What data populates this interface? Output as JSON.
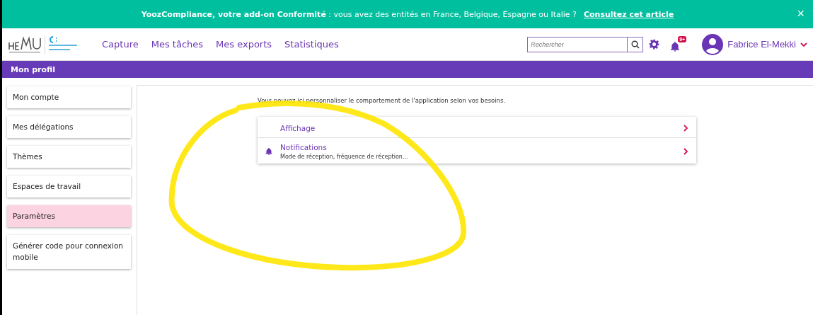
{
  "banner": {
    "text": "**YoozCompliance, votre add-on Conformité** : vous avez des entités en France, Belgique, Espagne ou Italie ?",
    "link": "Consultez cet article",
    "close": "×"
  },
  "header": {
    "nav": [
      {
        "label": "Capture"
      },
      {
        "label": "Mes tâches"
      },
      {
        "label": "Mes exports"
      },
      {
        "label": "Statistiques"
      }
    ],
    "search": {
      "placeholder": "Rechercher"
    },
    "notification_badge": "9+",
    "user": "Fabrice El-Mekki"
  },
  "page_title": "Mon profil",
  "sidebar": {
    "items": [
      {
        "label": "Mon compte",
        "selected": false
      },
      {
        "label": "Mes délégations",
        "selected": false
      },
      {
        "label": "Thèmes",
        "selected": false
      },
      {
        "label": "Espaces de travail",
        "selected": false
      },
      {
        "label": "Paramètres",
        "selected": true
      },
      {
        "label": "Générer code pour connexion mobile",
        "selected": false
      }
    ]
  },
  "content": {
    "intro": "Vous pouvez ici personnaliser le comportement de l'application selon vos besoins.",
    "settings": [
      {
        "title": "Affichage",
        "kind": "plain"
      },
      {
        "title": "Notifications",
        "subtitle": "Mode de réception, fréquence de réception...",
        "kind": "bell"
      }
    ]
  },
  "annotation": {
    "kind": "yellow-loop"
  }
}
